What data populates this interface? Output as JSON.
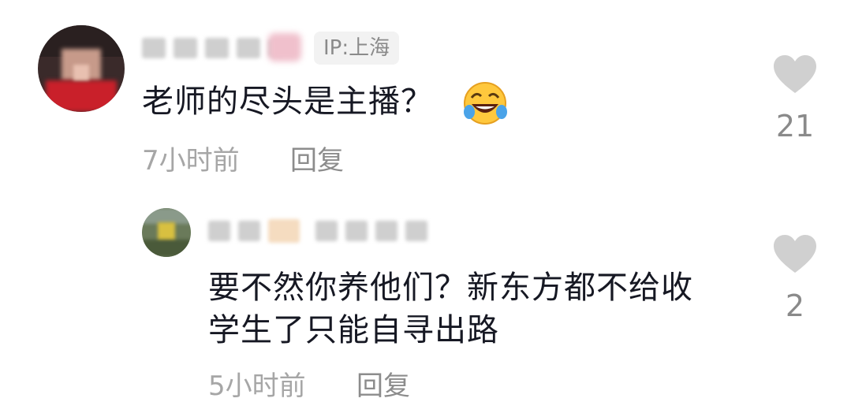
{
  "comments": [
    {
      "ip_label": "IP:上海",
      "text": "老师的尽头是主播？",
      "emoji": "laughing-crying-emoji",
      "time": "7小时前",
      "reply_label": "回复",
      "likes": "21"
    },
    {
      "text_line1": "要不然你养他们？新东方都不给收",
      "text_line2": "学生了只能自寻出路",
      "time": "5小时前",
      "reply_label": "回复",
      "likes": "2"
    }
  ],
  "icons": {
    "like": "heart-icon"
  },
  "colors": {
    "heart": "#d0d0d0",
    "text": "#161823",
    "meta": "#a6a6a6"
  }
}
